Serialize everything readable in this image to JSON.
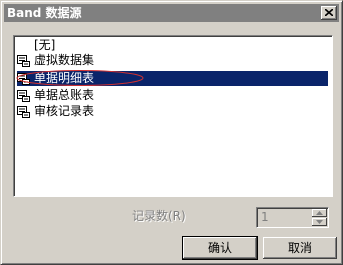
{
  "window": {
    "title": "Band 数据源"
  },
  "list": {
    "items": [
      {
        "label": "[无]",
        "icon": "none"
      },
      {
        "label": "虚拟数据集",
        "icon": "dataset-icon"
      },
      {
        "label": "单据明细表",
        "icon": "dataset-icon",
        "selected": true
      },
      {
        "label": "单据总账表",
        "icon": "dataset-icon"
      },
      {
        "label": "审核记录表",
        "icon": "dataset-icon"
      }
    ]
  },
  "record_count": {
    "label": "记录数(R)",
    "value": "1"
  },
  "buttons": {
    "ok": "确认",
    "cancel": "取消"
  },
  "colors": {
    "selection": "#0a246a",
    "annotation_ellipse": "#d03030"
  }
}
